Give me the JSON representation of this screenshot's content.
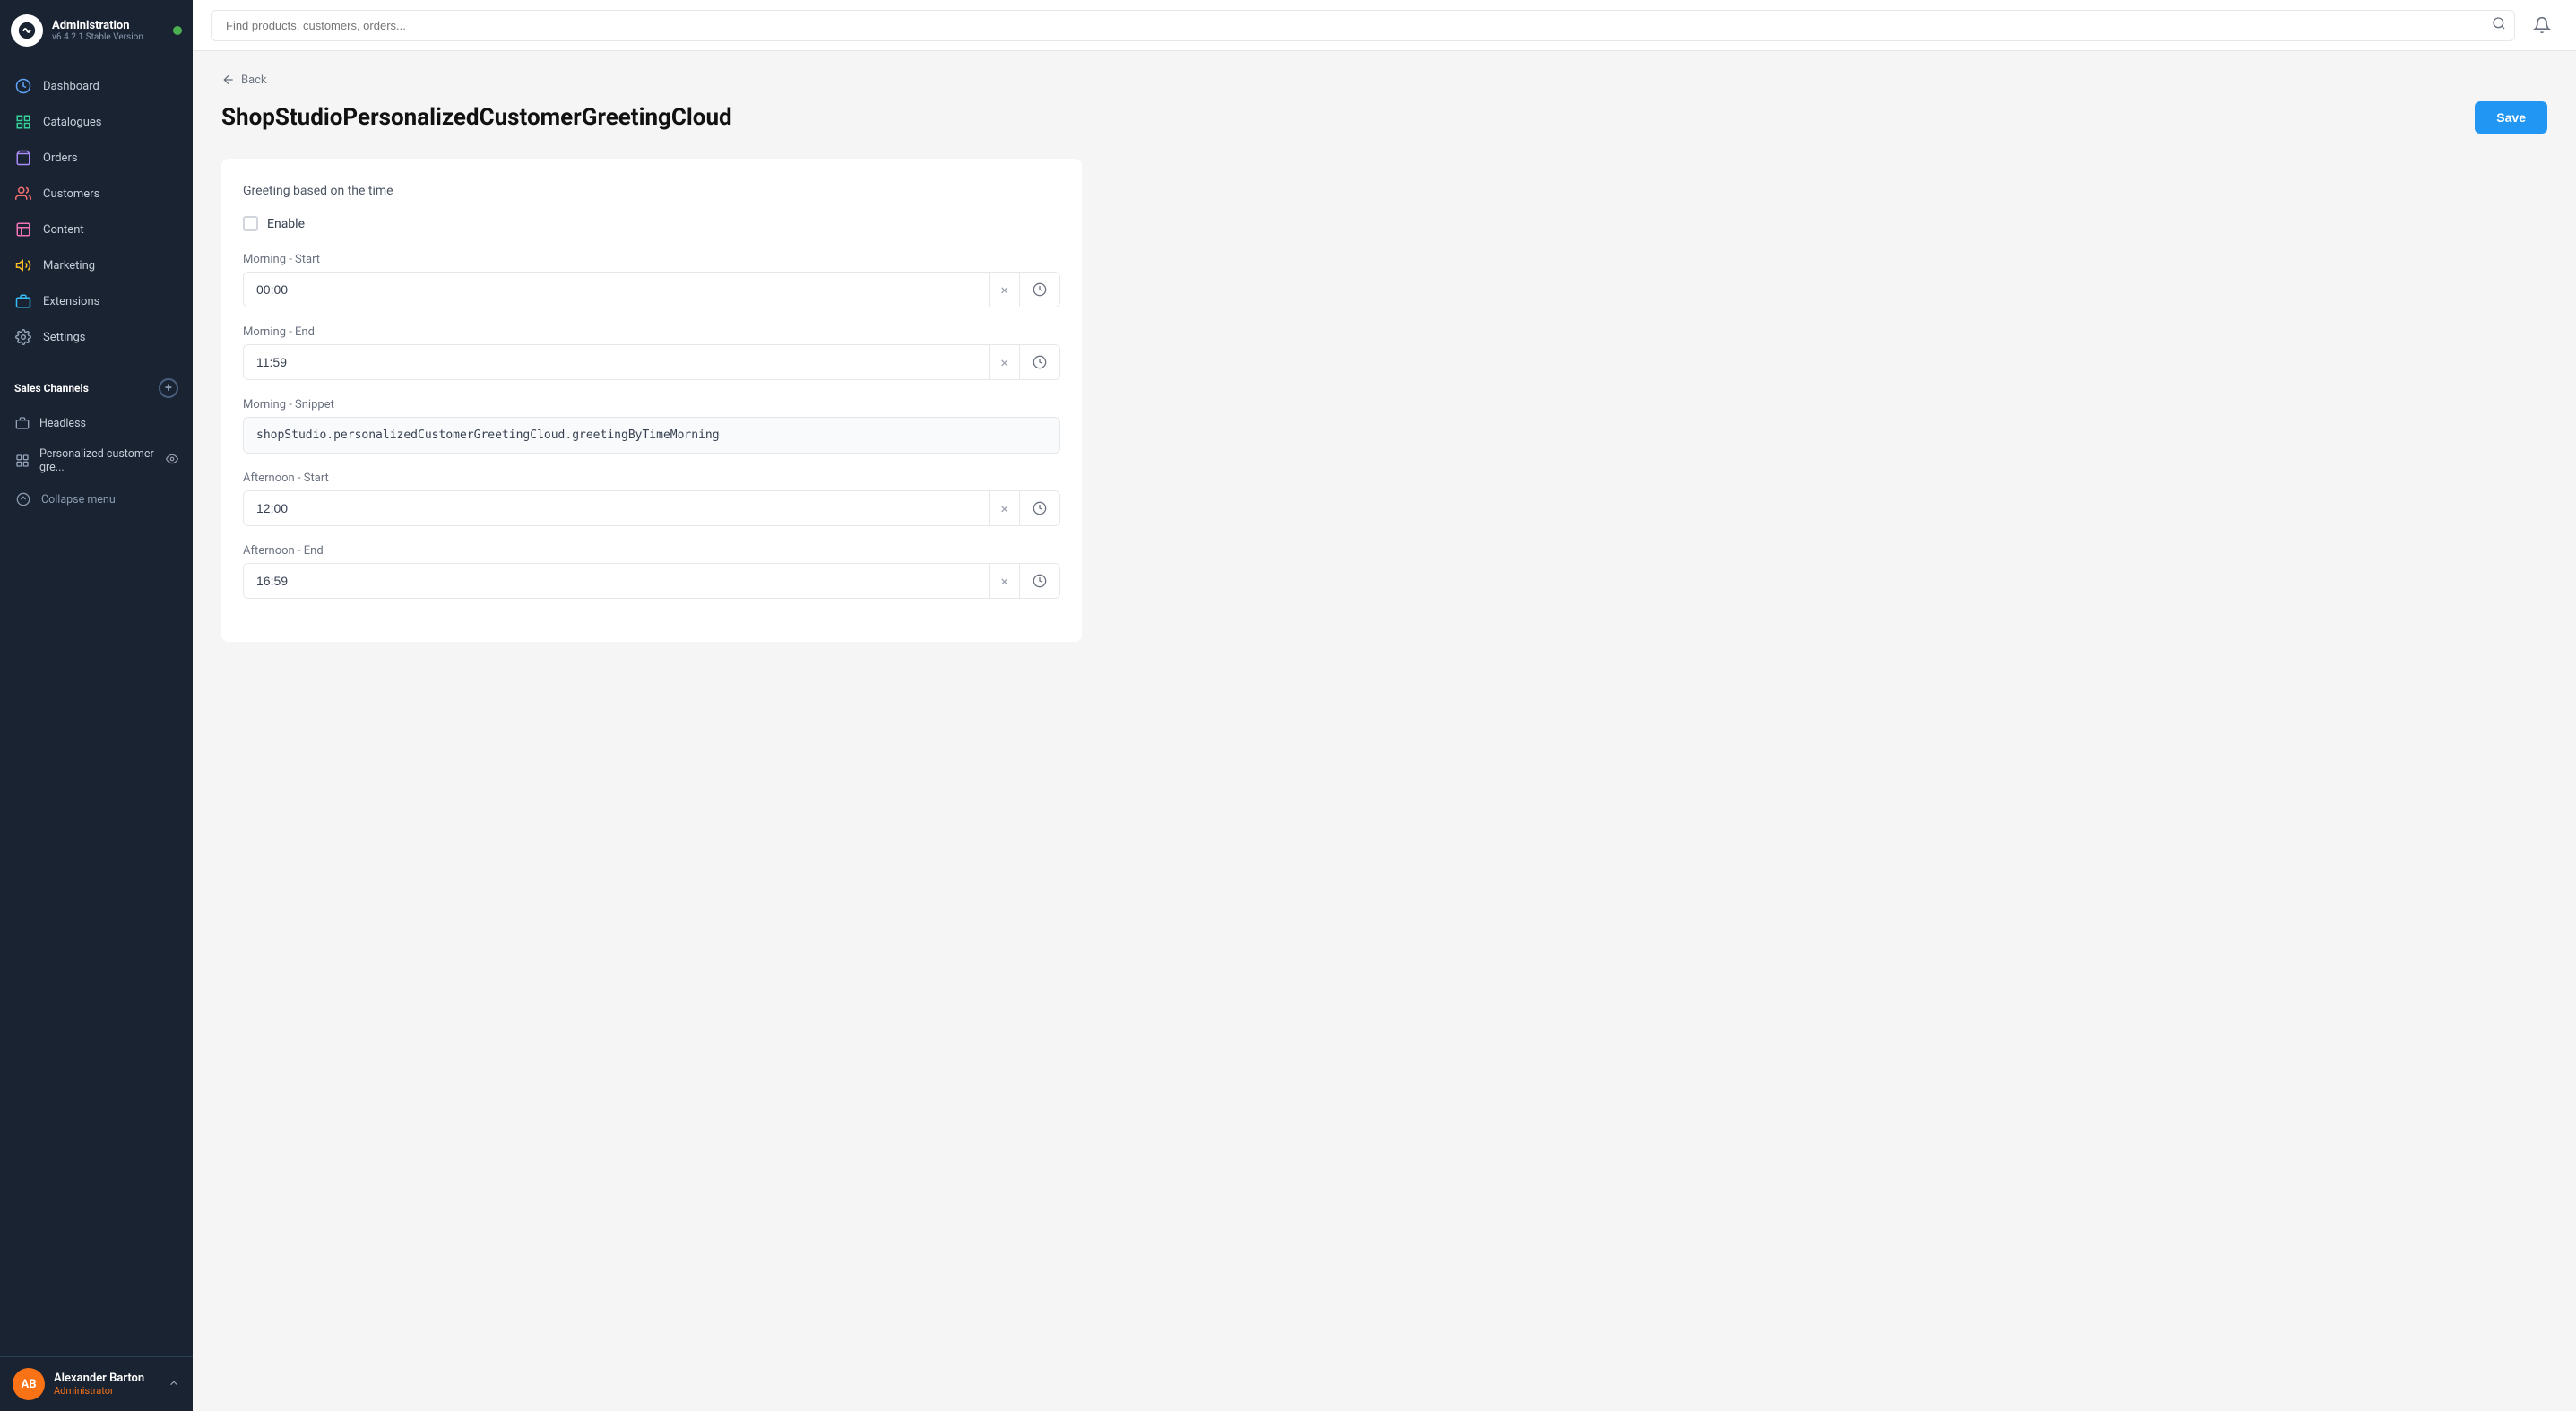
{
  "sidebar": {
    "logo_alt": "Saleor logo",
    "app_name": "Administration",
    "version": "v6.4.2.1 Stable Version",
    "online": true,
    "nav_items": [
      {
        "id": "dashboard",
        "label": "Dashboard",
        "icon": "dashboard"
      },
      {
        "id": "catalogues",
        "label": "Catalogues",
        "icon": "catalogues"
      },
      {
        "id": "orders",
        "label": "Orders",
        "icon": "orders"
      },
      {
        "id": "customers",
        "label": "Customers",
        "icon": "customers"
      },
      {
        "id": "content",
        "label": "Content",
        "icon": "content"
      },
      {
        "id": "marketing",
        "label": "Marketing",
        "icon": "marketing"
      },
      {
        "id": "extensions",
        "label": "Extensions",
        "icon": "extensions"
      },
      {
        "id": "settings",
        "label": "Settings",
        "icon": "settings"
      }
    ],
    "sales_channels_label": "Sales Channels",
    "sub_items": [
      {
        "id": "headless",
        "label": "Headless",
        "icon": "headless"
      },
      {
        "id": "personalized",
        "label": "Personalized customer gre...",
        "icon": "plugin",
        "has_eye": true
      }
    ],
    "collapse_label": "Collapse menu",
    "user": {
      "initials": "AB",
      "name": "Alexander Barton",
      "role": "Administrator"
    }
  },
  "topbar": {
    "search_placeholder": "Find products, customers, orders..."
  },
  "page": {
    "back_label": "Back",
    "title": "ShopStudioPersonalizedCustomerGreetingCloud",
    "save_label": "Save"
  },
  "form": {
    "section_title": "Greeting based on the time",
    "enable_label": "Enable",
    "fields": [
      {
        "id": "morning_start",
        "label": "Morning - Start",
        "value": "00:00",
        "type": "time"
      },
      {
        "id": "morning_end",
        "label": "Morning - End",
        "value": "11:59",
        "type": "time"
      },
      {
        "id": "morning_snippet",
        "label": "Morning - Snippet",
        "value": "shopStudio.personalizedCustomerGreetingCloud.greetingByTimeMorning",
        "type": "text"
      },
      {
        "id": "afternoon_start",
        "label": "Afternoon - Start",
        "value": "12:00",
        "type": "time"
      },
      {
        "id": "afternoon_end",
        "label": "Afternoon - End",
        "value": "16:59",
        "type": "time"
      }
    ]
  }
}
